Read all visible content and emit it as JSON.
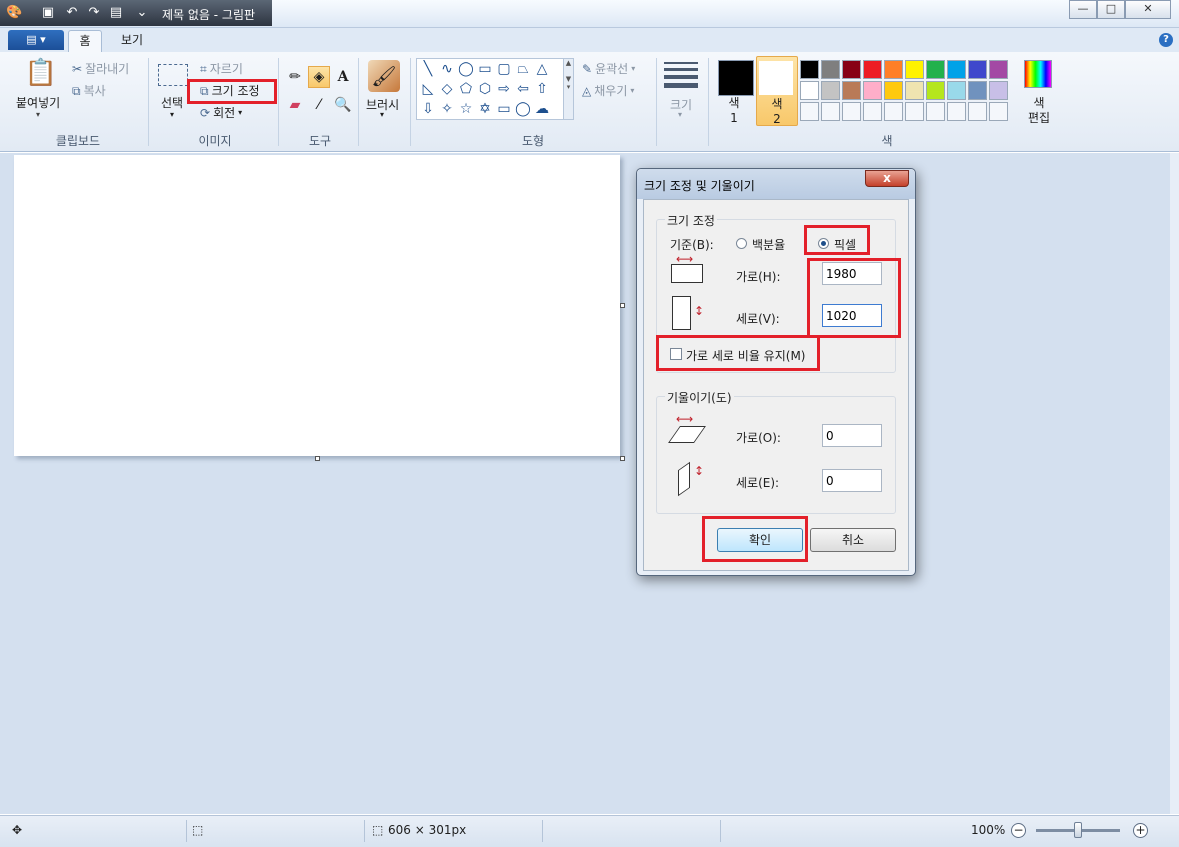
{
  "window": {
    "title": "제목 없음 - 그림판",
    "buttons": {
      "minimize": "▭",
      "maximize": "□",
      "close": "✕"
    }
  },
  "ribbon": {
    "tabs": [
      {
        "label": "홈"
      },
      {
        "label": "보기"
      }
    ],
    "clipboard": {
      "paste": "붙여넣기",
      "cut": "잘라내기",
      "copy": "복사",
      "group": "클립보드"
    },
    "image": {
      "select": "선택",
      "crop": "자르기",
      "resize": "크기 조정",
      "rotate": "회전",
      "group": "이미지"
    },
    "tools": {
      "group": "도구"
    },
    "brushes": {
      "label": "브러시"
    },
    "shapes": {
      "outline": "윤곽선",
      "fill": "채우기",
      "group": "도형"
    },
    "size": {
      "label": "크기"
    },
    "colors": {
      "color1": "색\n1",
      "color1_line1": "색",
      "color1_line2": "1",
      "color2_line1": "색",
      "color2_line2": "2",
      "edit_line1": "색",
      "edit_line2": "편집",
      "group": "색",
      "color1_value": "#000000",
      "color2_value": "#ffffff",
      "palette_row1": [
        "#000000",
        "#7f7f7f",
        "#880015",
        "#ed1c24",
        "#ff7f27",
        "#fff200",
        "#22b14c",
        "#00a2e8",
        "#3f48cc",
        "#a349a4"
      ],
      "palette_row2": [
        "#ffffff",
        "#c3c3c3",
        "#b97a57",
        "#ffaec9",
        "#ffc90e",
        "#efe4b0",
        "#b5e61d",
        "#99d9ea",
        "#7092be",
        "#c8bfe7"
      ]
    }
  },
  "status": {
    "canvas_size": "606 × 301px",
    "zoom": "100%"
  },
  "dialog": {
    "title": "크기 조정 및 기울이기",
    "resize_group": "크기 조정",
    "basis_label": "기준(B):",
    "percent_label": "백분율",
    "pixel_label": "픽셀",
    "horizontal_label": "가로(H):",
    "horizontal_value": "1980",
    "vertical_label": "세로(V):",
    "vertical_value": "1020",
    "keep_ratio_label": "가로 세로 비율 유지(M)",
    "skew_group": "기울이기(도)",
    "skew_h_label": "가로(O):",
    "skew_h_value": "0",
    "skew_v_label": "세로(E):",
    "skew_v_value": "0",
    "ok_label": "확인",
    "cancel_label": "취소",
    "close_label": "x"
  }
}
